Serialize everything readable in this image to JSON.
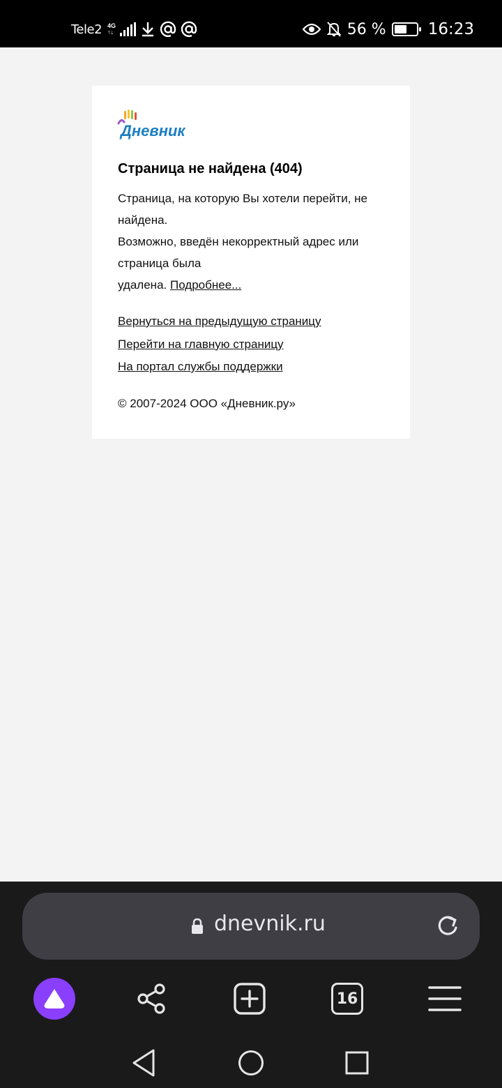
{
  "status_bar": {
    "carrier": "Tele2",
    "network_type": "4G",
    "battery_percent_text": "56 %",
    "battery_level": 0.56,
    "time": "16:23",
    "icons": [
      "download-icon",
      "at-icon",
      "at-icon",
      "eye-icon",
      "bell-off-icon",
      "battery-icon"
    ]
  },
  "page": {
    "logo_text": "Дневник",
    "title": "Страница не найдена (404)",
    "description_line1": "Страница, на которую Вы хотели перейти, не найдена.",
    "description_line2": "Возможно, введён некорректный адрес или страница была",
    "description_line3": "удалена.",
    "more_link": "Подробнее...",
    "links": [
      "Вернуться на предыдущую страницу",
      "Перейти на главную страницу",
      "На портал службы поддержки"
    ],
    "copyright": "© 2007-2024 ООО «Дневник.ру»"
  },
  "browser": {
    "url": "dnevnik.ru",
    "tabs_count": "16",
    "accent_color": "#8a3ffc",
    "toolbar_icons": [
      "alice-icon",
      "share-icon",
      "new-tab-icon",
      "tabs-icon",
      "menu-icon"
    ]
  },
  "navigation": {
    "buttons": [
      "back-icon",
      "home-icon",
      "recents-icon"
    ]
  }
}
